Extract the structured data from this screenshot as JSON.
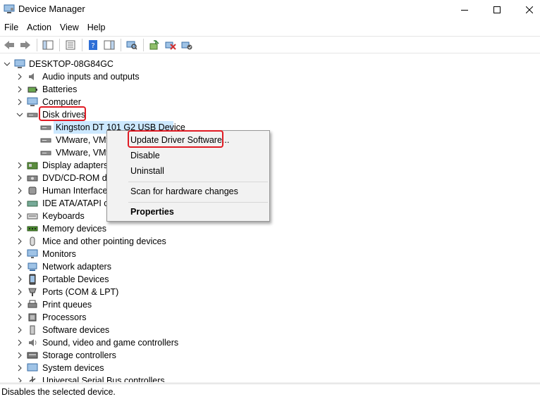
{
  "window": {
    "title": "Device Manager"
  },
  "menu": [
    "File",
    "Action",
    "View",
    "Help"
  ],
  "tree": {
    "root": "DESKTOP-08G84GC",
    "items": [
      {
        "label": "Audio inputs and outputs",
        "icon": "speaker-icon",
        "expanded": false
      },
      {
        "label": "Batteries",
        "icon": "battery-icon",
        "expanded": false
      },
      {
        "label": "Computer",
        "icon": "computer-icon",
        "expanded": false
      },
      {
        "label": "Disk drives",
        "icon": "disk-drive-icon",
        "expanded": true
      },
      {
        "label": "Kingston DT 101 G2 USB Device",
        "icon": "disk-drive-icon",
        "child": true,
        "selected": true
      },
      {
        "label": "VMware, VMv",
        "icon": "disk-drive-icon",
        "child": true
      },
      {
        "label": "VMware, VMv",
        "icon": "disk-drive-icon",
        "child": true
      },
      {
        "label": "Display adapters",
        "icon": "display-adapter-icon",
        "expanded": false
      },
      {
        "label": "DVD/CD-ROM dr",
        "icon": "dvd-icon",
        "expanded": false
      },
      {
        "label": "Human Interface",
        "icon": "hid-icon",
        "expanded": false
      },
      {
        "label": "IDE ATA/ATAPI co",
        "icon": "ide-icon",
        "expanded": false
      },
      {
        "label": "Keyboards",
        "icon": "keyboard-icon",
        "expanded": false
      },
      {
        "label": "Memory devices",
        "icon": "memory-icon",
        "expanded": false
      },
      {
        "label": "Mice and other pointing devices",
        "icon": "mouse-icon",
        "expanded": false
      },
      {
        "label": "Monitors",
        "icon": "monitor-icon",
        "expanded": false
      },
      {
        "label": "Network adapters",
        "icon": "network-icon",
        "expanded": false
      },
      {
        "label": "Portable Devices",
        "icon": "portable-device-icon",
        "expanded": false
      },
      {
        "label": "Ports (COM & LPT)",
        "icon": "port-icon",
        "expanded": false
      },
      {
        "label": "Print queues",
        "icon": "printer-icon",
        "expanded": false
      },
      {
        "label": "Processors",
        "icon": "processor-icon",
        "expanded": false
      },
      {
        "label": "Software devices",
        "icon": "software-device-icon",
        "expanded": false
      },
      {
        "label": "Sound, video and game controllers",
        "icon": "sound-icon",
        "expanded": false
      },
      {
        "label": "Storage controllers",
        "icon": "storage-controller-icon",
        "expanded": false
      },
      {
        "label": "System devices",
        "icon": "system-device-icon",
        "expanded": false
      },
      {
        "label": "Universal Serial Bus controllers",
        "icon": "usb-icon",
        "expanded": false
      }
    ]
  },
  "context_menu": {
    "update": "Update Driver Software...",
    "disable": "Disable",
    "uninstall": "Uninstall",
    "scan": "Scan for hardware changes",
    "properties": "Properties"
  },
  "status": "Disables the selected device.",
  "colors": {
    "highlight": "#e01b24",
    "selection": "#cce8ff"
  }
}
